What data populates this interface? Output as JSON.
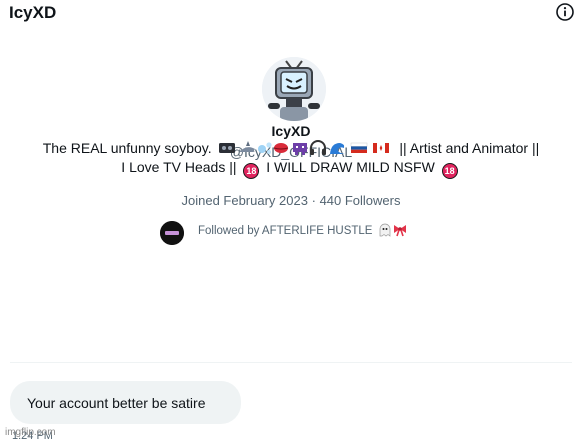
{
  "header": {
    "title": "IcyXD",
    "info_icon": "info-circle-icon"
  },
  "profile": {
    "display_name": "IcyXD",
    "handle": "@IcyXD_OFFICIAL",
    "avatar_icon": "tv-head-character-avatar",
    "bio_line1_start": "The REAL unfunny soyboy.",
    "bio_line1_end": "|| Artist and Animator ||",
    "bio_line2_start": "I Love TV Heads ||",
    "bio_line2_mid": "I WILL DRAW MILD NSFW",
    "badge18": "18",
    "emoji_icons": [
      "vhs-tape-icon",
      "shark-icon",
      "bubbles-icon",
      "kiss-mouth-icon",
      "alien-monster-icon",
      "headphones-icon",
      "wave-icon",
      "russia-flag-icon",
      "canada-flag-icon"
    ],
    "joined": "Joined February 2023",
    "separator": "·",
    "followers": "440 Followers",
    "followed_by": "Followed by AFTERLIFE HUSTLE"
  },
  "message": {
    "text": "Your account better be satire",
    "time": "1:24 PM"
  },
  "watermark": "imgflip.com",
  "colors": {
    "text": "#0f1419",
    "secondary": "#536471",
    "bubble": "#eff3f4",
    "divider": "#eff3f4"
  }
}
